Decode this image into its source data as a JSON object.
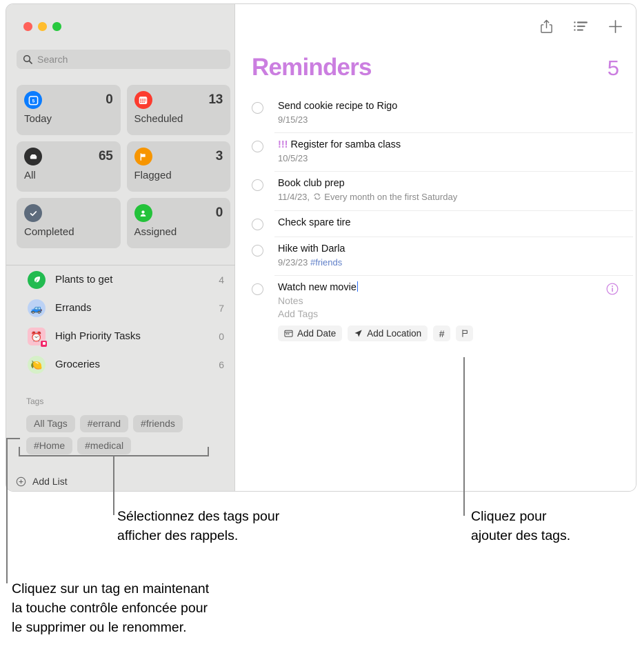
{
  "window": {
    "traffic_lights": [
      "close",
      "minimize",
      "zoom"
    ],
    "colors": {
      "accent_purple": "#cb7ee0",
      "tag_blue": "#5f7fc8",
      "sidebar_bg": "#e5e5e4",
      "card_bg": "#d3d3d2"
    }
  },
  "sidebar": {
    "search": {
      "placeholder": "Search",
      "value": "",
      "icon": "search-icon"
    },
    "smart_lists": [
      {
        "label": "Today",
        "count": "0",
        "icon": "calendar-day-icon",
        "icon_color": "#0a7cff",
        "glyph": "5"
      },
      {
        "label": "Scheduled",
        "count": "13",
        "icon": "calendar-icon",
        "icon_color": "#fc3b2f"
      },
      {
        "label": "All",
        "count": "65",
        "icon": "inbox-icon",
        "icon_color": "#2f2f2f"
      },
      {
        "label": "Flagged",
        "count": "3",
        "icon": "flag-icon",
        "icon_color": "#f79500"
      },
      {
        "label": "Completed",
        "count": "",
        "icon": "check-circle-icon",
        "icon_color": "#5d6b7c"
      },
      {
        "label": "Assigned",
        "count": "0",
        "icon": "person-icon",
        "icon_color": "#23c23a"
      }
    ],
    "lists": [
      {
        "name": "Plants to get",
        "count": "4",
        "emoji": "🌿",
        "bg": "#22bb50",
        "icon": "leaf-icon"
      },
      {
        "name": "Errands",
        "count": "7",
        "emoji": "🚙",
        "bg": "#bcd2f5",
        "icon": "car-icon"
      },
      {
        "name": "High Priority Tasks",
        "count": "0",
        "emoji": "⏰",
        "bg": "#fbc2ce",
        "icon": "alarm-clock-icon"
      },
      {
        "name": "Groceries",
        "count": "6",
        "emoji": "🍋",
        "bg": "#d6f0c8",
        "icon": "lemon-icon"
      }
    ],
    "tags_header": "Tags",
    "tags": [
      "All Tags",
      "#errand",
      "#friends",
      "#Home",
      "#medical"
    ],
    "add_list": {
      "label": "Add List",
      "icon": "plus-circle-icon"
    }
  },
  "main": {
    "toolbar": [
      {
        "name": "share-button",
        "icon": "share-icon"
      },
      {
        "name": "view-options-button",
        "icon": "list-sort-icon"
      },
      {
        "name": "add-reminder-button",
        "icon": "plus-icon"
      }
    ],
    "title": "Reminders",
    "count": "5",
    "reminders": [
      {
        "title": "Send cookie recipe to Rigo",
        "priority": "",
        "date": "9/15/23",
        "repeat": "",
        "tag": ""
      },
      {
        "title": "Register for samba class",
        "priority": "!!!",
        "date": "10/5/23",
        "repeat": "",
        "tag": ""
      },
      {
        "title": "Book club prep",
        "priority": "",
        "date": "11/4/23,",
        "repeat": "Every month on the first Saturday",
        "tag": ""
      },
      {
        "title": "Check spare tire",
        "priority": "",
        "date": "",
        "repeat": "",
        "tag": ""
      },
      {
        "title": "Hike with Darla",
        "priority": "",
        "date": "9/23/23",
        "repeat": "",
        "tag": "#friends"
      }
    ],
    "editing_reminder": {
      "title": "Watch new movie",
      "notes_placeholder": "Notes",
      "tags_placeholder": "Add Tags",
      "buttons": [
        {
          "label": "Add Date",
          "icon": "calendar-small-icon"
        },
        {
          "label": "Add Location",
          "icon": "location-arrow-icon"
        },
        {
          "label": "#",
          "icon": "hash-icon"
        },
        {
          "label": "",
          "icon": "flag-outline-icon"
        }
      ],
      "info_icon": "info-circle-icon"
    }
  },
  "callouts": [
    {
      "id": "tags-callout",
      "line1": "Sélectionnez des tags pour",
      "line2": "afficher des rappels.",
      "line3": ""
    },
    {
      "id": "hash-callout",
      "line1": "Cliquez pour",
      "line2": "ajouter des tags.",
      "line3": ""
    },
    {
      "id": "tag-context-callout",
      "line1": "Cliquez sur un tag en maintenant",
      "line2": "la touche contrôle enfoncée pour",
      "line3": "le supprimer ou le renommer."
    }
  ]
}
